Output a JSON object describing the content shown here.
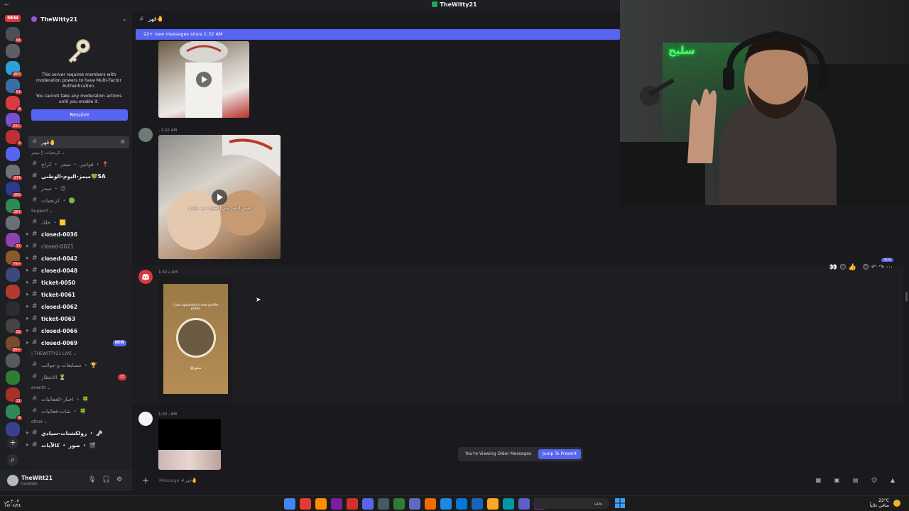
{
  "window": {
    "title": "TheWitty21",
    "back_glyph": "←"
  },
  "rail": {
    "new_badge": "NEW",
    "servers": [
      {
        "color": "#4e5058",
        "count": "94"
      },
      {
        "color": "#5c5f66",
        "count": ""
      },
      {
        "color": "#2aa0d8",
        "count": "807"
      },
      {
        "color": "#3a6ea5",
        "count": "54"
      },
      {
        "color": "#d83c3e",
        "count": "8"
      },
      {
        "color": "#7b4fd0",
        "count": "2K+"
      },
      {
        "color": "#c03030",
        "count": "3"
      },
      {
        "color": "#5865f2",
        "count": ""
      },
      {
        "color": "#6f7378",
        "count": "274"
      },
      {
        "color": "#2d3a8c",
        "count": "355"
      },
      {
        "color": "#2e8b57",
        "count": "267"
      },
      {
        "color": "#6a6f75",
        "count": ""
      },
      {
        "color": "#8e44ad",
        "count": "17"
      },
      {
        "color": "#8b5a2b",
        "count": "7K+"
      },
      {
        "color": "#3c4a7a",
        "count": ""
      },
      {
        "color": "#b03a2e",
        "count": ""
      },
      {
        "color": "#2b2d31",
        "count": ""
      },
      {
        "color": "#444444",
        "count": "SS"
      },
      {
        "color": "#7a4b2a",
        "count": "9K+"
      },
      {
        "color": "#555a60",
        "count": ""
      },
      {
        "color": "#2e7d32",
        "count": ""
      },
      {
        "color": "#a93226",
        "count": "11"
      },
      {
        "color": "#2e8b57",
        "count": "8"
      },
      {
        "color": "#3b3f8f",
        "count": ""
      }
    ],
    "label_under": "عربيكلمة"
  },
  "sidebar": {
    "server_name": "TheWitty21",
    "mfa_text_1": "This server requires members with moderation powers to have Multi-Factor Authentication.",
    "mfa_text_2": "You cannot take any moderation actions until you enable it.",
    "resolve_label": "Resolve",
    "channels": [
      {
        "type": "channel",
        "name": "قهر🤚",
        "state": "active",
        "tools": "⚙"
      },
      {
        "type": "category",
        "name": "كرتجيات || ميمز ⌄"
      },
      {
        "type": "channel",
        "name": "قوانين ・ ميمز ・ كراج ・ 📍",
        "state": "muted"
      },
      {
        "type": "channel",
        "name": "ميمز-اليوم-الوطني💚SA",
        "state": "bold"
      },
      {
        "type": "channel",
        "name": "ميمز ・ 😊",
        "state": "muted"
      },
      {
        "type": "channel",
        "name": "كرتجيات ・ 🟢",
        "state": "muted"
      },
      {
        "type": "category",
        "name": "Support ⌄"
      },
      {
        "type": "channel",
        "name": "خلك ・ 🟨",
        "state": "muted"
      },
      {
        "type": "channel",
        "name": "closed-0036",
        "state": "bold",
        "arrow": true
      },
      {
        "type": "channel",
        "name": "closed-0021",
        "state": "muted",
        "arrow": true
      },
      {
        "type": "channel",
        "name": "closed-0042",
        "state": "bold",
        "arrow": true
      },
      {
        "type": "channel",
        "name": "closed-0048",
        "state": "bold",
        "arrow": true
      },
      {
        "type": "channel",
        "name": "ticket-0050",
        "state": "bold",
        "arrow": true
      },
      {
        "type": "channel",
        "name": "ticket-0061",
        "state": "bold",
        "arrow": true
      },
      {
        "type": "channel",
        "name": "closed-0062",
        "state": "bold",
        "arrow": true
      },
      {
        "type": "channel",
        "name": "ticket-0063",
        "state": "bold",
        "arrow": true
      },
      {
        "type": "channel",
        "name": "closed-0066",
        "state": "bold",
        "arrow": true
      },
      {
        "type": "channel",
        "name": "closed-0069",
        "state": "bold",
        "arrow": true,
        "badge": "NEW"
      },
      {
        "type": "category",
        "name": "| THEWITTY21 LIVE ⌄"
      },
      {
        "type": "channel",
        "name": "مسابقات و جوائب ・ 🏆",
        "state": "muted"
      },
      {
        "type": "channel",
        "name": "الانتظار ⏳",
        "state": "muted",
        "red_badge": "13"
      },
      {
        "type": "category",
        "name": "events ⌄"
      },
      {
        "type": "channel",
        "name": "اخبار-الفعاليات ・ 🍀",
        "state": "muted"
      },
      {
        "type": "channel",
        "name": "شات-فعاليات ・ 🍀",
        "state": "muted"
      },
      {
        "type": "category",
        "name": "other ⌄"
      },
      {
        "type": "channel",
        "name": "رولكشنات-سيادي ・ 🗝",
        "state": "bold",
        "arrow": true
      },
      {
        "type": "channel",
        "name": "صور ・ كالآيات ・ 🎬",
        "state": "bold",
        "arrow": true
      }
    ]
  },
  "user": {
    "name": "TheWitt21",
    "status": "Invisible"
  },
  "chat": {
    "channel_name": "قهر🤚",
    "new_messages_bar": "22+ new messages since 1:32 AM",
    "messages": [
      {
        "time": "1:32 AM",
        "prefix": "،"
      },
      {
        "time": "1:32 AM",
        "prefix": "ة"
      },
      {
        "time": "1:32 AM",
        "prefix": "ـ"
      }
    ],
    "video_caption": "نفس الشي بس أعطيتك حبه شلش",
    "reaction_icons": "👀😊👍 😊↶↷⋯",
    "new_tag": "NEW",
    "phone_text": "I just uploaded a new profile photo",
    "phone_sub": "@سليح",
    "older_text": "You're Viewing Older Messages",
    "jump_label": "Jump To Present",
    "composer_placeholder": "Message #قهر🤚",
    "composer_icons": "▦ ▣ ▤ ☺ ▲"
  },
  "webcam": {
    "neon_sign": "سليح"
  },
  "taskbar": {
    "clock_left_1": "٢:٠٣ ص",
    "clock_left_2": "١٧/٠٤/٢٤",
    "search_placeholder": "بحث",
    "temp": "22°C",
    "weather": "صافي غالباً"
  },
  "colors": {
    "accent": "#5865f2",
    "danger": "#da373c",
    "green": "#23a55a"
  }
}
